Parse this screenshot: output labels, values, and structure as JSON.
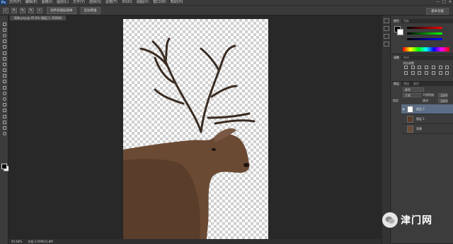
{
  "menubar": {
    "app_logo": "Ps",
    "items": [
      "文件(F)",
      "编辑(E)",
      "图像(I)",
      "图层(L)",
      "文字(Y)",
      "选择(S)",
      "滤镜(T)",
      "3D(D)",
      "视图(V)",
      "窗口(W)",
      "帮助(H)"
    ],
    "window_controls": [
      "—",
      "□",
      "✕"
    ]
  },
  "optionsbar": {
    "refine_label": "对所有图层取样",
    "edge_label": "自动增强",
    "workspace_label": "基本功能"
  },
  "document": {
    "tab_label": "雨林.png @ 45.6% (图层 1, RGB/8)"
  },
  "statusbar": {
    "zoom": "45.64%",
    "doc_info": "文档:3.05M/21.8M"
  },
  "panels": {
    "color_tabs": [
      "颜色",
      "色板"
    ],
    "adjust_tabs": [
      "调整",
      "样式"
    ],
    "adjust_title": "添加调整",
    "layers_tabs": [
      "图层",
      "通道",
      "路径"
    ],
    "kind_label": "类型",
    "blend_mode": "正常",
    "opacity_label": "不透明度:",
    "opacity_value": "100%",
    "lock_label": "锁定:",
    "fill_label": "填充:",
    "fill_value": "100%",
    "layers": [
      {
        "name": "图层 2",
        "selected": true
      },
      {
        "name": "图层 1",
        "selected": false
      },
      {
        "name": "背景",
        "selected": false
      }
    ]
  },
  "watermark": {
    "text": "津门网"
  },
  "colors": {
    "accent_layer_selected": "#5c6d86",
    "panel_bg": "#3c3c3c",
    "canvas_bg": "#282828"
  }
}
